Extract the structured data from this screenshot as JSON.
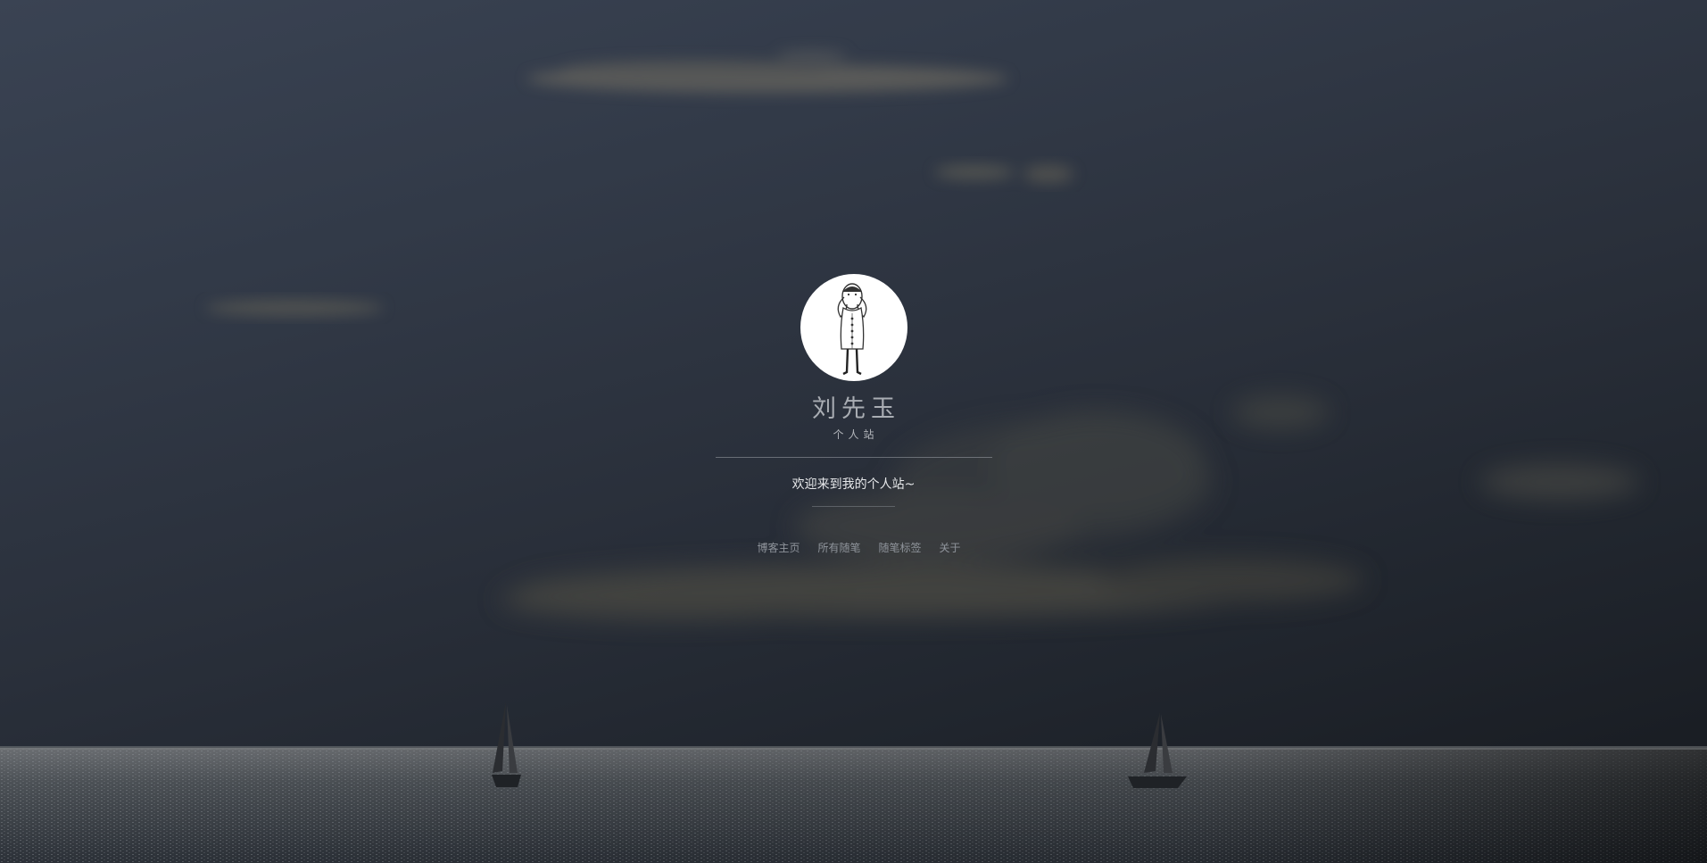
{
  "profile": {
    "name": "刘先玉",
    "subtitle": "个人站",
    "avatar_icon": "cartoon-person-icon"
  },
  "welcome": {
    "text": "欢迎来到我的个人站~"
  },
  "nav": {
    "items": [
      {
        "label": "博客主页"
      },
      {
        "label": "所有随笔"
      },
      {
        "label": "随笔标签"
      },
      {
        "label": "关于"
      }
    ]
  },
  "colors": {
    "sky_top": "#3a4353",
    "sky_bottom": "#16191e",
    "title_text": "#a9adb3",
    "welcome_text": "#e6e8ea",
    "nav_text": "#8f949b"
  }
}
